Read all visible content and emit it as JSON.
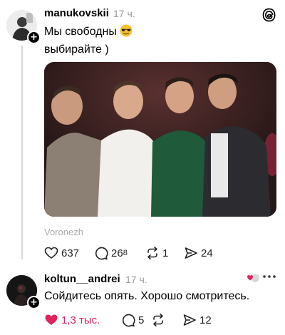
{
  "post": {
    "username": "manukovskii",
    "time": "17 ч.",
    "text_line1": "Мы свободны",
    "text_line2": "выбирайте )",
    "emoji_icon": "sunglasses-face-icon",
    "location": "Voronezh",
    "stats": {
      "likes": "637",
      "comments": "26",
      "comments_sup": "8",
      "reposts": "1",
      "shares": "24"
    }
  },
  "reply": {
    "username": "koltun__andrei",
    "time": "17 ч.",
    "text": "Сойдитесь опять. Хорошо смотритесь.",
    "stats": {
      "likes": "1,3 тыс.",
      "comments": "5",
      "reposts": "",
      "shares": "12"
    }
  },
  "icons": [
    "threads-logo-icon",
    "heart-icon",
    "comment-icon",
    "repost-icon",
    "share-icon",
    "more-icon",
    "plus-icon"
  ],
  "colors": {
    "liked": "#e0245e",
    "muted": "#9a9a9a",
    "thread_line": "#d9d9d9"
  }
}
